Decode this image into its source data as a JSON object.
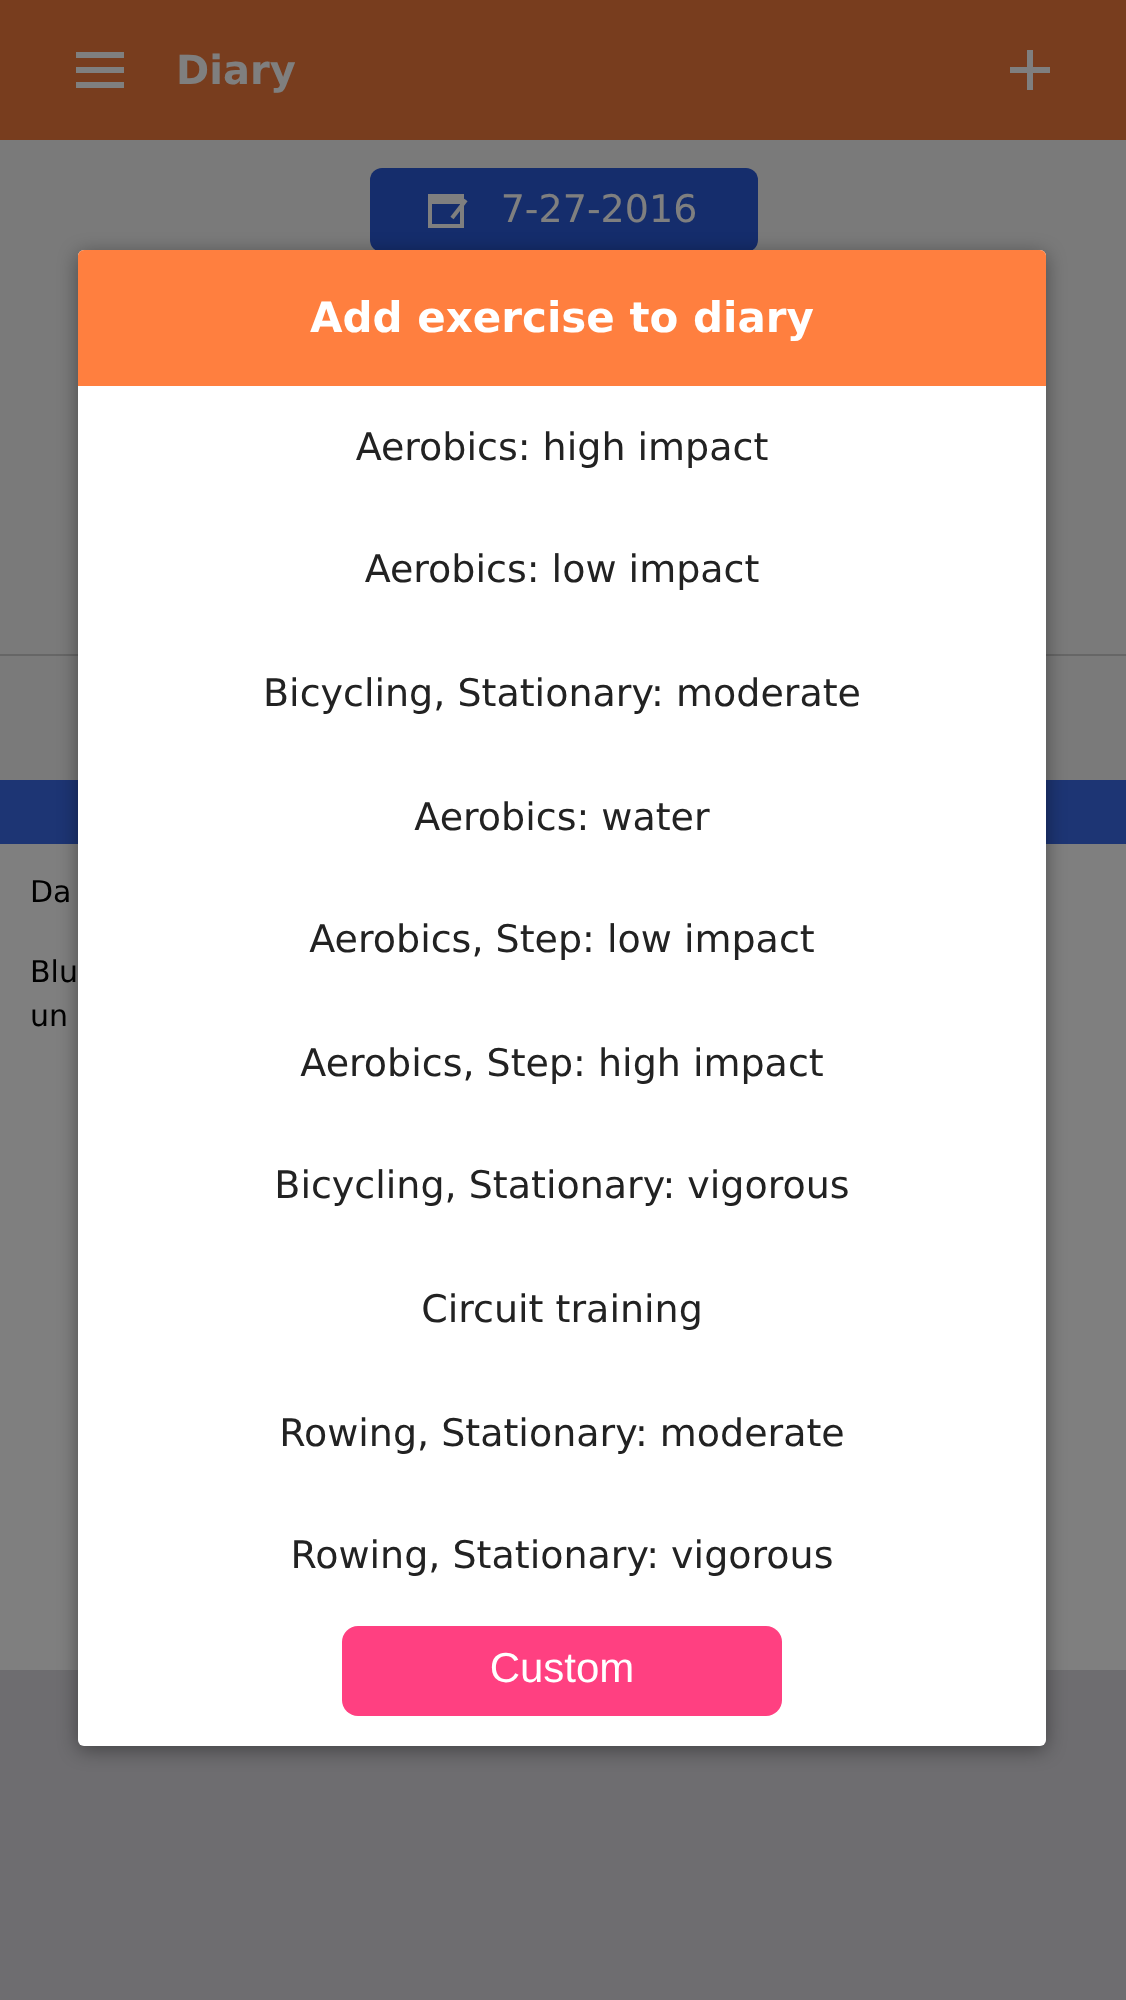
{
  "app_bar": {
    "title": "Diary"
  },
  "date_button": {
    "label": "7-27-2016"
  },
  "background_rows": [
    {
      "text": "Da"
    },
    {
      "text": "Blu\nun"
    }
  ],
  "dialog": {
    "title": "Add exercise to diary",
    "options": [
      "Aerobics: high impact",
      "Aerobics: low impact",
      "Bicycling, Stationary: moderate",
      "Aerobics: water",
      "Aerobics, Step: low impact",
      "Aerobics, Step: high impact",
      "Bicycling, Stationary: vigorous",
      "Circuit training",
      "Rowing, Stationary: moderate",
      "Rowing, Stationary: vigorous"
    ],
    "button": "Custom"
  }
}
